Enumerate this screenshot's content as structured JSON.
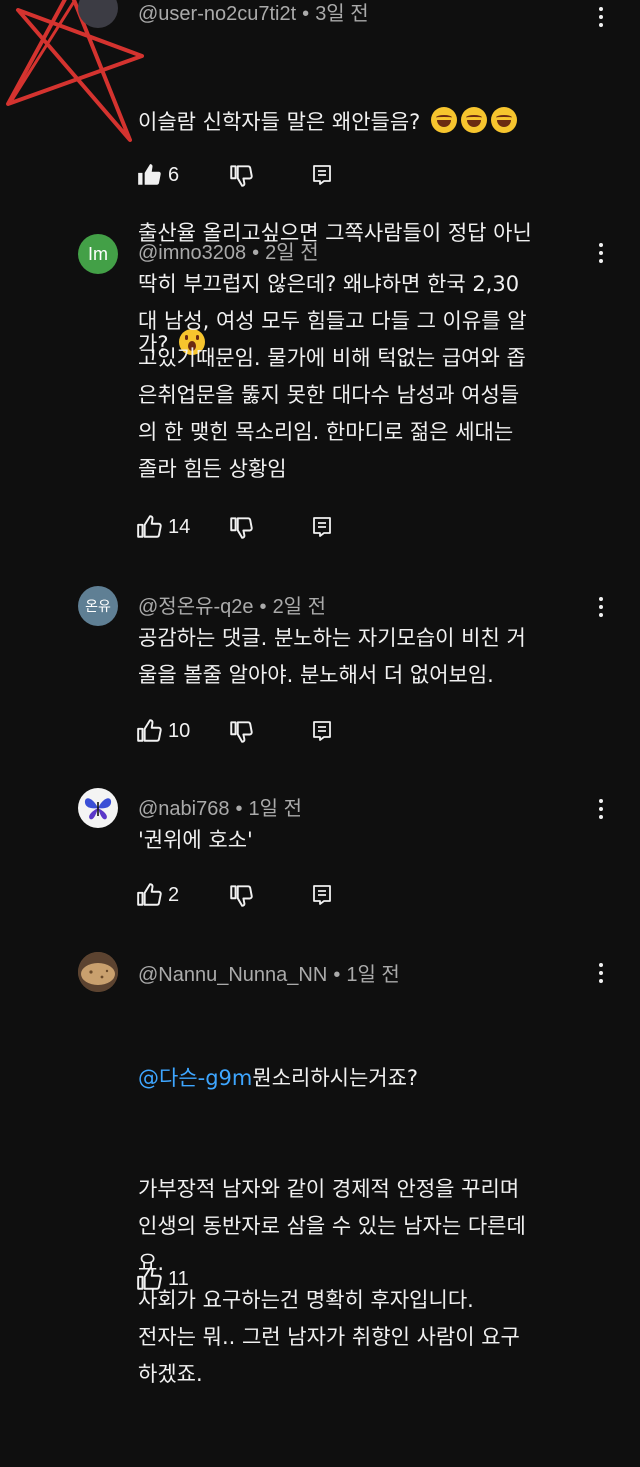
{
  "comments": [
    {
      "handle": "@user-no2cu7ti2t",
      "time": "3일 전",
      "lines": [
        "이슬람 신학자들 말은 왜안들음?",
        "출산율 올리고싶으면 그쪽사람들이 정답 아닌",
        "가?"
      ],
      "emoji_line1": [
        "face-with-tears-of-joy",
        "face-with-tears-of-joy",
        "face-with-tears-of-joy"
      ],
      "emoji_line3": [
        "hushed-face"
      ],
      "likes": "6",
      "liked": true
    },
    {
      "handle": "@imno3208",
      "time": "2일 전",
      "avatar_text": "Im",
      "avatar_color": "#43a047",
      "text": "딱히 부끄럽지 않은데? 왜냐하면 한국 2,30\n대 남성, 여성 모두 힘들고 다들 그 이유를 알\n고있기때문임. 물가에 비해 턱없는 급여와 좁\n은취업문을 뚫지 못한 대다수 남성과 여성들\n의 한 맺힌 목소리임. 한마디로 젊은 세대는\n졸라 힘든 상황임",
      "likes": "14"
    },
    {
      "handle": "@정온유-q2e",
      "time": "2일 전",
      "avatar_text": "온유",
      "avatar_color": "#5f7f94",
      "text": "공감하는 댓글. 분노하는 자기모습이 비친 거\n울을 볼줄 알아야. 분노해서 더 없어보임.",
      "likes": "10"
    },
    {
      "handle": "@nabi768",
      "time": "1일 전",
      "avatar_icon": "butterfly-icon",
      "text": "'권위에 호소'",
      "likes": "2"
    },
    {
      "handle": "@Nannu_Nunna_NN",
      "time": "1일 전",
      "mention": "@다슨-g9m",
      "first_line_rest": "뭔소리하시는거죠?",
      "text": "가부장적 남자와 같이 경제적 안정을 꾸리며\n인생의 동반자로 삼을 수 있는 남자는 다른데\n요.\n사회가 요구하는건 명확히 후자입니다.\n전자는 뭐.. 그런 남자가 취향인 사람이 요구\n하겠죠.",
      "likes": "11"
    }
  ],
  "colors": {
    "background": "#0f0f0f",
    "text": "#f1f1f1",
    "meta": "#aaaaaa",
    "mention": "#3ea6ff"
  }
}
